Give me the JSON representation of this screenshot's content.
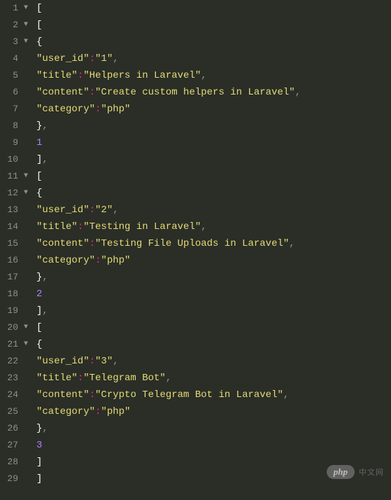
{
  "lines": [
    {
      "n": 1,
      "fold": true,
      "indent": 0,
      "open": "[",
      "close": ""
    },
    {
      "n": 2,
      "fold": true,
      "indent": 1,
      "open": "[",
      "close": ""
    },
    {
      "n": 3,
      "fold": true,
      "indent": 2,
      "open": "{",
      "close": ""
    },
    {
      "n": 4,
      "fold": false,
      "indent": 3,
      "key": "user_id",
      "value": "1",
      "comma": true
    },
    {
      "n": 5,
      "fold": false,
      "indent": 3,
      "key": "title",
      "value": "Helpers in Laravel",
      "comma": true
    },
    {
      "n": 6,
      "fold": false,
      "indent": 3,
      "key": "content",
      "value": "Create custom helpers in Laravel",
      "comma": true
    },
    {
      "n": 7,
      "fold": false,
      "indent": 3,
      "key": "category",
      "value": "php",
      "comma": false
    },
    {
      "n": 8,
      "fold": false,
      "indent": 2,
      "open": "}",
      "close": ","
    },
    {
      "n": 9,
      "fold": false,
      "indent": 2,
      "number": "1"
    },
    {
      "n": 10,
      "fold": false,
      "indent": 1,
      "open": "]",
      "close": ","
    },
    {
      "n": 11,
      "fold": true,
      "indent": 1,
      "open": "[",
      "close": ""
    },
    {
      "n": 12,
      "fold": true,
      "indent": 2,
      "open": "{",
      "close": ""
    },
    {
      "n": 13,
      "fold": false,
      "indent": 3,
      "key": "user_id",
      "value": "2",
      "comma": true
    },
    {
      "n": 14,
      "fold": false,
      "indent": 3,
      "key": "title",
      "value": "Testing in Laravel",
      "comma": true
    },
    {
      "n": 15,
      "fold": false,
      "indent": 3,
      "key": "content",
      "value": "Testing File Uploads in Laravel",
      "comma": true
    },
    {
      "n": 16,
      "fold": false,
      "indent": 3,
      "key": "category",
      "value": "php",
      "comma": false
    },
    {
      "n": 17,
      "fold": false,
      "indent": 2,
      "open": "}",
      "close": ","
    },
    {
      "n": 18,
      "fold": false,
      "indent": 2,
      "number": "2"
    },
    {
      "n": 19,
      "fold": false,
      "indent": 1,
      "open": "]",
      "close": ","
    },
    {
      "n": 20,
      "fold": true,
      "indent": 1,
      "open": "[",
      "close": ""
    },
    {
      "n": 21,
      "fold": true,
      "indent": 2,
      "open": "{",
      "close": ""
    },
    {
      "n": 22,
      "fold": false,
      "indent": 3,
      "key": "user_id",
      "value": "3",
      "comma": true
    },
    {
      "n": 23,
      "fold": false,
      "indent": 3,
      "key": "title",
      "value": "Telegram Bot",
      "comma": true
    },
    {
      "n": 24,
      "fold": false,
      "indent": 3,
      "key": "content",
      "value": "Crypto Telegram Bot in Laravel",
      "comma": true
    },
    {
      "n": 25,
      "fold": false,
      "indent": 3,
      "key": "category",
      "value": "php",
      "comma": false
    },
    {
      "n": 26,
      "fold": false,
      "indent": 2,
      "open": "}",
      "close": ","
    },
    {
      "n": 27,
      "fold": false,
      "indent": 2,
      "number": "3"
    },
    {
      "n": 28,
      "fold": false,
      "indent": 1,
      "open": "]",
      "close": ""
    },
    {
      "n": 29,
      "fold": false,
      "indent": 0,
      "open": "]",
      "close": ""
    }
  ],
  "fold_glyph": "▼",
  "watermark": {
    "badge": "php",
    "text": "中文网"
  }
}
